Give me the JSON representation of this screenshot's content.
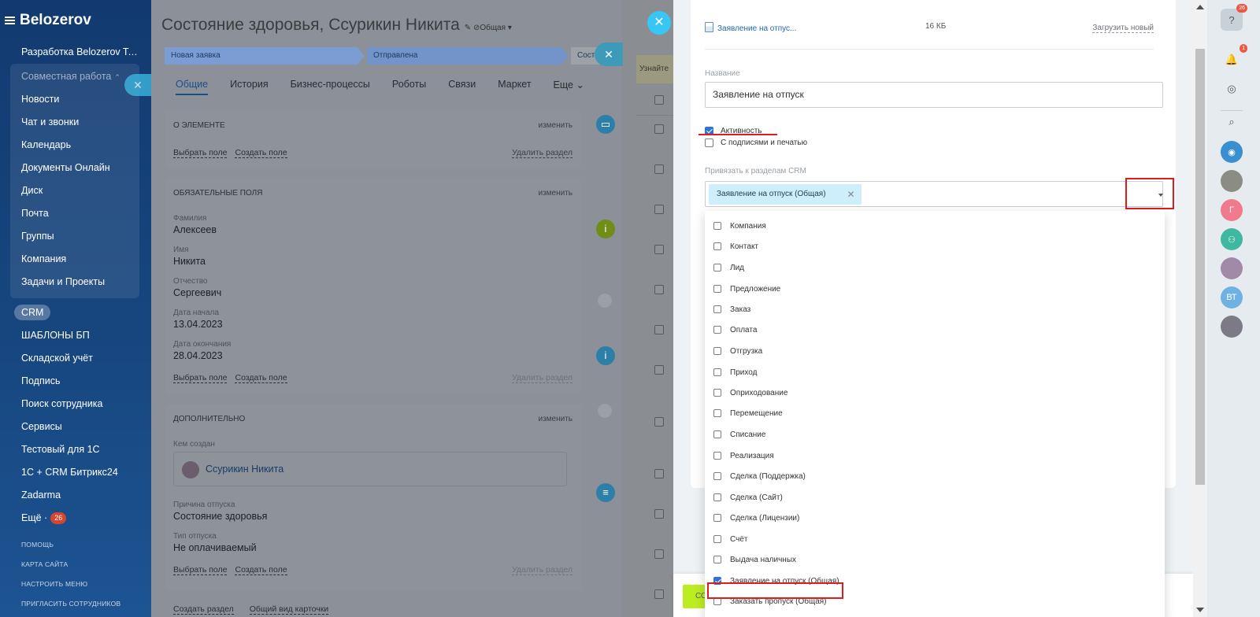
{
  "sidebar": {
    "logo": "Belozerov",
    "top_item": "Разработка Belozerov Tea...",
    "group_header": "Совместная работа",
    "group_items": [
      "Новости",
      "Чат и звонки",
      "Календарь",
      "Документы Онлайн",
      "Диск",
      "Почта",
      "Группы",
      "Компания",
      "Задачи и Проекты"
    ],
    "crm": "CRM",
    "items": [
      "ШАБЛОНЫ БП",
      "Складской учёт",
      "Подпись",
      "Поиск сотрудника",
      "Сервисы",
      "Тестовый для 1С",
      "1С + CRM Битрикс24",
      "Zadarma"
    ],
    "more": "Ещё ·",
    "more_badge": "26",
    "links": [
      "ПОМОЩЬ",
      "КАРТА САЙТА",
      "НАСТРОИТЬ МЕНЮ",
      "ПРИГЛАСИТЬ СОТРУДНИКОВ"
    ]
  },
  "card": {
    "title": "Состояние здоровья, Ссурикин Никита",
    "category": "Общая",
    "stages": [
      "Новая заявка",
      "Отправлена",
      "Сост"
    ],
    "tabs": [
      "Общие",
      "История",
      "Бизнес-процессы",
      "Роботы",
      "Связи",
      "Маркет",
      "Еще"
    ],
    "section1": {
      "title": "О ЭЛЕМЕНТЕ",
      "edit": "изменить",
      "pick": "Выбрать поле",
      "create": "Создать поле",
      "delete": "Удалить раздел"
    },
    "section2": {
      "title": "ОБЯЗАТЕЛЬНЫЕ ПОЛЯ",
      "edit": "изменить",
      "fields": [
        {
          "label": "Фамилия",
          "value": "Алексеев"
        },
        {
          "label": "Имя",
          "value": "Никита"
        },
        {
          "label": "Отчество",
          "value": "Сергеевич"
        },
        {
          "label": "Дата начала",
          "value": "13.04.2023"
        },
        {
          "label": "Дата окончания",
          "value": "28.04.2023"
        }
      ],
      "pick": "Выбрать поле",
      "create": "Создать поле",
      "delete": "Удалить раздел"
    },
    "section3": {
      "title": "ДОПОЛНИТЕЛЬНО",
      "edit": "изменить",
      "created_by_label": "Кем создан",
      "created_by": "Ссурикин Никита",
      "reason_label": "Причина отпуска",
      "reason": "Состояние здоровья",
      "type_label": "Тип отпуска",
      "type": "Не оплачиваемый",
      "pick": "Выбрать поле",
      "create": "Создать поле",
      "delete": "Удалить раздел"
    },
    "footer_create": "Создать раздел",
    "footer_view": "Общий вид карточки"
  },
  "mid": {
    "yellow_text": "Узнайте"
  },
  "doc": {
    "file_name": "Заявление на отпус...",
    "file_size": "16 КБ",
    "upload_new": "Загрузить новый",
    "name_label": "Название",
    "name_value": "Заявление на отпуск",
    "active_label": "Активность",
    "stamps_label": "С подписями и печатью",
    "crm_label": "Привязать к разделам CRM",
    "selected_tag": "Заявление на отпуск (Общая)",
    "save_label": "СО"
  },
  "dropdown": {
    "items": [
      {
        "label": "Компания",
        "checked": false
      },
      {
        "label": "Контакт",
        "checked": false
      },
      {
        "label": "Лид",
        "checked": false
      },
      {
        "label": "Предложение",
        "checked": false
      },
      {
        "label": "Заказ",
        "checked": false
      },
      {
        "label": "Оплата",
        "checked": false
      },
      {
        "label": "Отгрузка",
        "checked": false
      },
      {
        "label": "Приход",
        "checked": false
      },
      {
        "label": "Оприходование",
        "checked": false
      },
      {
        "label": "Перемещение",
        "checked": false
      },
      {
        "label": "Списание",
        "checked": false
      },
      {
        "label": "Реализация",
        "checked": false
      },
      {
        "label": "Сделка (Поддержка)",
        "checked": false
      },
      {
        "label": "Сделка (Сайт)",
        "checked": false
      },
      {
        "label": "Сделка (Лицензии)",
        "checked": false
      },
      {
        "label": "Счёт",
        "checked": false
      },
      {
        "label": "Выдача наличных",
        "checked": false
      },
      {
        "label": "Заявление на отпуск (Общая)",
        "checked": true
      },
      {
        "label": "Заказать пропуск (Общая)",
        "checked": false
      }
    ]
  },
  "right_bar": {
    "help_badge": "26",
    "notif_badge": "1",
    "avatar_letter_g": "Г",
    "avatar_letters_vt": "ВТ"
  },
  "colors": {
    "accent_blue": "#2f72d8",
    "highlight_red": "#e01b1b",
    "save_green": "#bbed21",
    "tag_bg": "#cdeefa"
  }
}
